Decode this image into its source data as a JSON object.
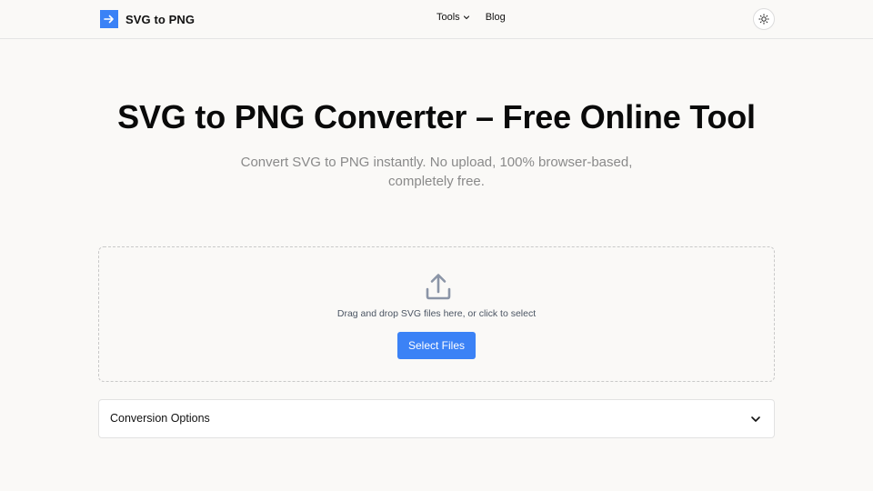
{
  "header": {
    "brand_name": "SVG to PNG",
    "brand_icon": "arrow-right-icon",
    "nav": [
      {
        "label": "Tools",
        "has_dropdown": true
      },
      {
        "label": "Blog",
        "has_dropdown": false
      }
    ],
    "theme_toggle_icon": "sun-icon"
  },
  "hero": {
    "title": "SVG to PNG Converter – Free Online Tool",
    "subtitle": "Convert SVG to PNG instantly. No upload, 100% browser-based, completely free."
  },
  "dropzone": {
    "icon": "upload-icon",
    "text": "Drag and drop SVG files here, or click to select",
    "button_label": "Select Files"
  },
  "options": {
    "label": "Conversion Options",
    "expanded": false
  },
  "colors": {
    "accent": "#3b82f6",
    "background": "#faf9f7",
    "muted_text": "#8a8a8a"
  }
}
